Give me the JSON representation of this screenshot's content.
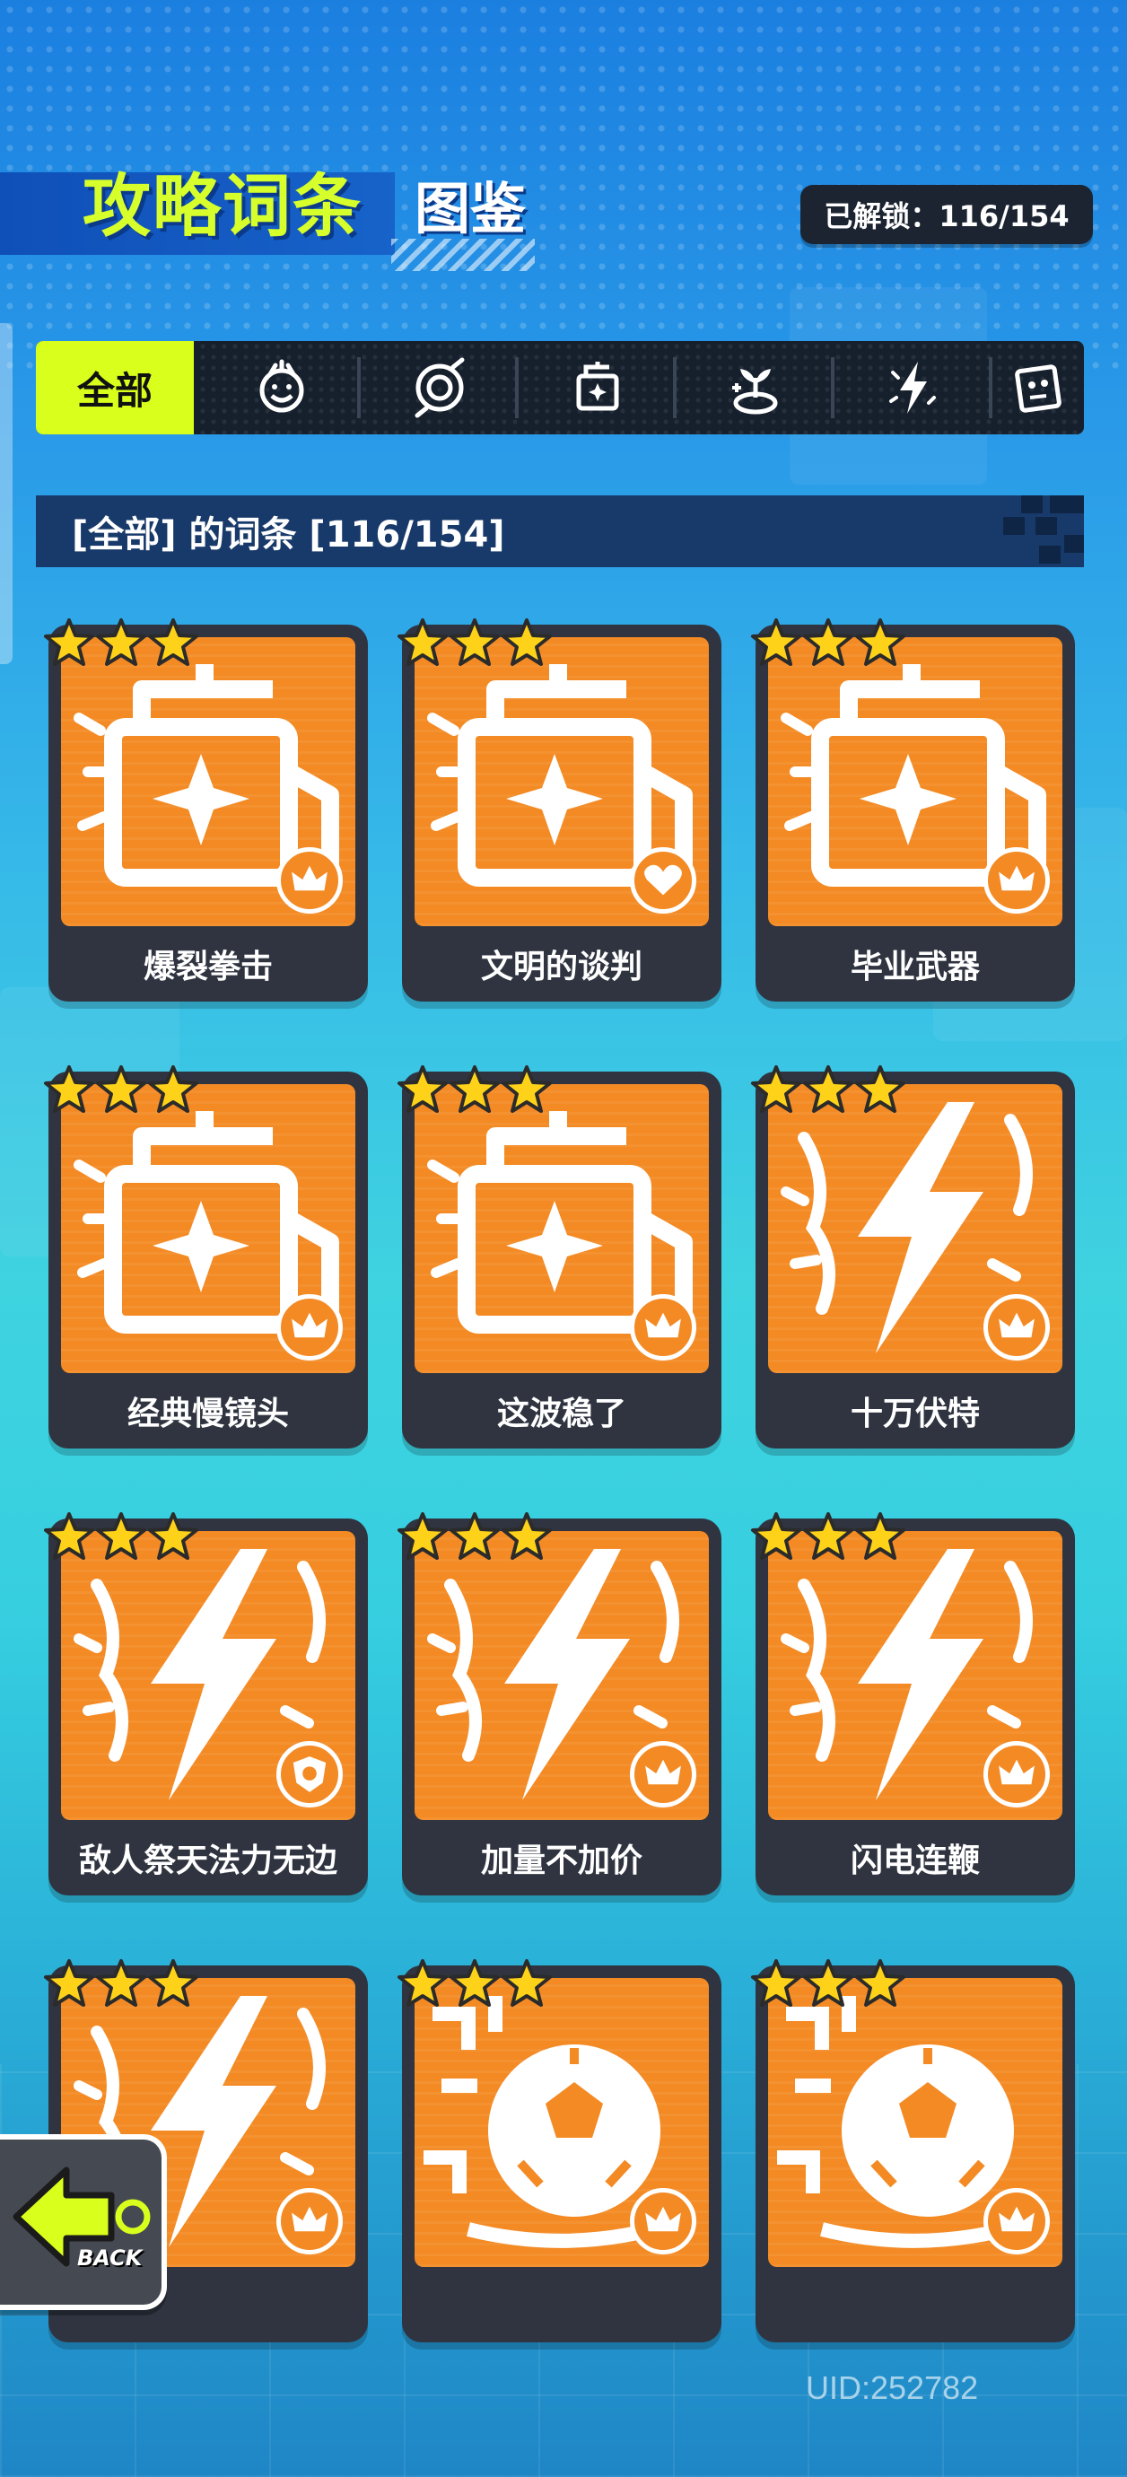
{
  "header": {
    "title_main": "攻略词条",
    "title_sub": "图鉴",
    "unlock": "已解锁：116/154"
  },
  "tabs": [
    {
      "label": "全部",
      "icon": "all"
    },
    {
      "label": "",
      "icon": "fist-face-icon"
    },
    {
      "label": "",
      "icon": "spiral-target-icon"
    },
    {
      "label": "",
      "icon": "cannon-device-icon"
    },
    {
      "label": "",
      "icon": "healing-plant-icon"
    },
    {
      "label": "",
      "icon": "lightning-icon"
    },
    {
      "label": "",
      "icon": "robot-box-icon"
    }
  ],
  "section": {
    "title": "[全部] 的词条 [116/154]"
  },
  "cards": [
    {
      "name": "爆裂拳击",
      "icon": "cannon-device-icon",
      "stars": 3,
      "badge": "crown-icon"
    },
    {
      "name": "文明的谈判",
      "icon": "cannon-device-icon",
      "stars": 3,
      "badge": "heart-icon"
    },
    {
      "name": "毕业武器",
      "icon": "cannon-device-icon",
      "stars": 3,
      "badge": "crown-icon"
    },
    {
      "name": "经典慢镜头",
      "icon": "cannon-device-icon",
      "stars": 3,
      "badge": "crown-icon"
    },
    {
      "name": "这波稳了",
      "icon": "cannon-device-icon",
      "stars": 3,
      "badge": "crown-icon"
    },
    {
      "name": "十万伏特",
      "icon": "lightning-icon",
      "stars": 3,
      "badge": "crown-icon"
    },
    {
      "name": "敌人祭天法力无边",
      "icon": "lightning-icon",
      "stars": 3,
      "badge": "shield-icon"
    },
    {
      "name": "加量不加价",
      "icon": "lightning-icon",
      "stars": 3,
      "badge": "crown-icon"
    },
    {
      "name": "闪电连鞭",
      "icon": "lightning-icon",
      "stars": 3,
      "badge": "crown-icon"
    },
    {
      "name": "",
      "icon": "lightning-icon",
      "stars": 3,
      "badge": "crown-icon"
    },
    {
      "name": "",
      "icon": "ball-icon",
      "stars": 3,
      "badge": "crown-icon"
    },
    {
      "name": "",
      "icon": "ball-icon",
      "stars": 3,
      "badge": "crown-icon"
    }
  ],
  "back": {
    "label": "BACK"
  },
  "footer": {
    "uid": "UID:252782"
  },
  "colors": {
    "accent": "#d9ff1c",
    "card_art": "#f38a24",
    "card_frame": "#2f3440",
    "tabbar": "#16202d",
    "section": "#183a6a"
  }
}
